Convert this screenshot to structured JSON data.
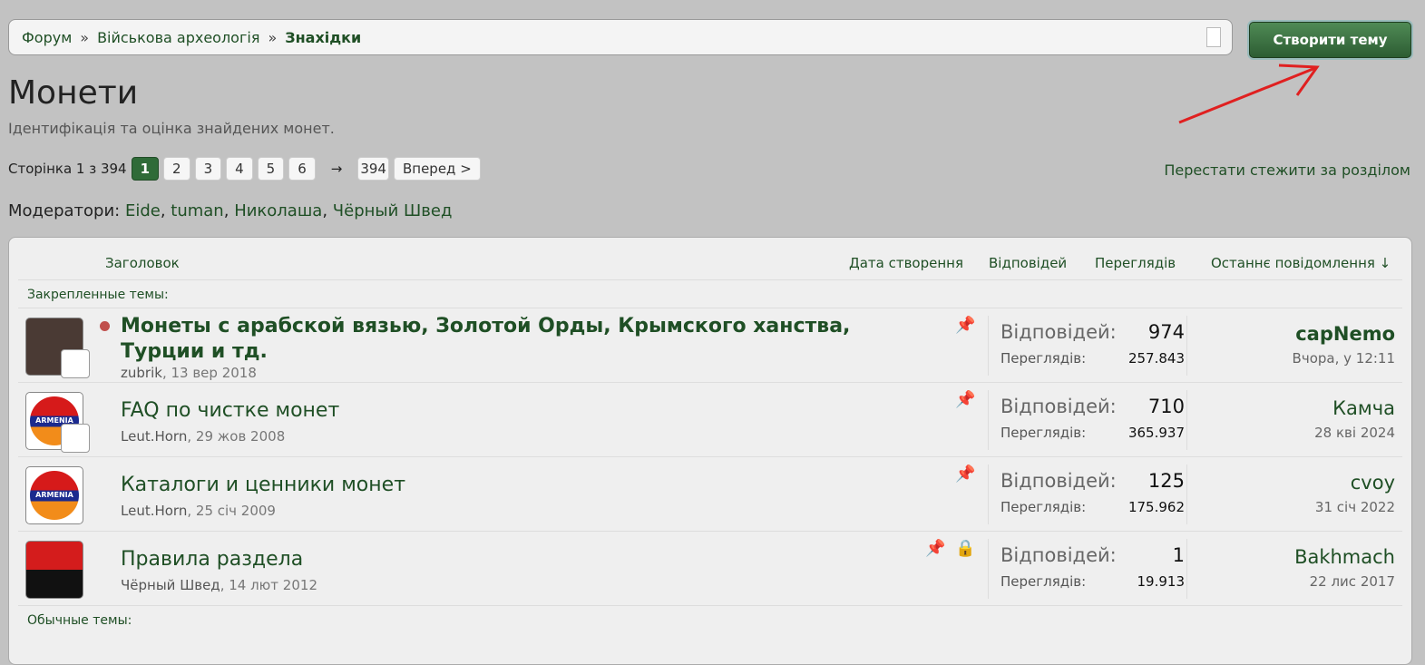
{
  "breadcrumb": {
    "items": [
      "Форум",
      "Військова археологія"
    ],
    "current": "Знахідки",
    "sep": "»"
  },
  "create_button": "Створити тему",
  "page_title": "Монети",
  "description": "Ідентифікація та оцінка знайдених монет.",
  "pager": {
    "label": "Сторінка 1 з 394",
    "pages": [
      "1",
      "2",
      "3",
      "4",
      "5",
      "6"
    ],
    "arrow": "→",
    "last": "394",
    "next": "Вперед >"
  },
  "unwatch": "Перестати стежити за розділом",
  "moderators": {
    "label": "Модератори:",
    "names": [
      "Eide",
      "tuman",
      "Николаша",
      "Чёрный Швед"
    ]
  },
  "columns": {
    "title": "Заголовок",
    "created": "Дата створення",
    "replies": "Відповідей",
    "views": "Переглядів",
    "last": "Останнє повідомлення ↓"
  },
  "sticky_label": "Закрепленные темы:",
  "normal_label": "Обычные темы:",
  "stat_labels": {
    "replies": "Відповідей:",
    "views": "Переглядів:"
  },
  "avatar_text": "ARMENIA",
  "threads": [
    {
      "title": "Монеты с арабской вязью, Золотой Орды, Крымского ханства, Турции и тд.",
      "author": "zubrik",
      "date": "13 вер 2018",
      "replies": "974",
      "views": "257.843",
      "last_user": "capNemo",
      "last_date": "Вчора, у 12:11"
    },
    {
      "title": "FAQ по чистке монет",
      "author": "Leut.Horn",
      "date": "29 жов 2008",
      "replies": "710",
      "views": "365.937",
      "last_user": "Камча",
      "last_date": "28 кві 2024"
    },
    {
      "title": "Каталоги и ценники монет",
      "author": "Leut.Horn",
      "date": "25 січ 2009",
      "replies": "125",
      "views": "175.962",
      "last_user": "cvoy",
      "last_date": "31 січ 2022"
    },
    {
      "title": "Правила раздела",
      "author": "Чёрный Швед",
      "date": "14 лют 2012",
      "replies": "1",
      "views": "19.913",
      "last_user": "Bakhmach",
      "last_date": "22 лис 2017"
    }
  ]
}
